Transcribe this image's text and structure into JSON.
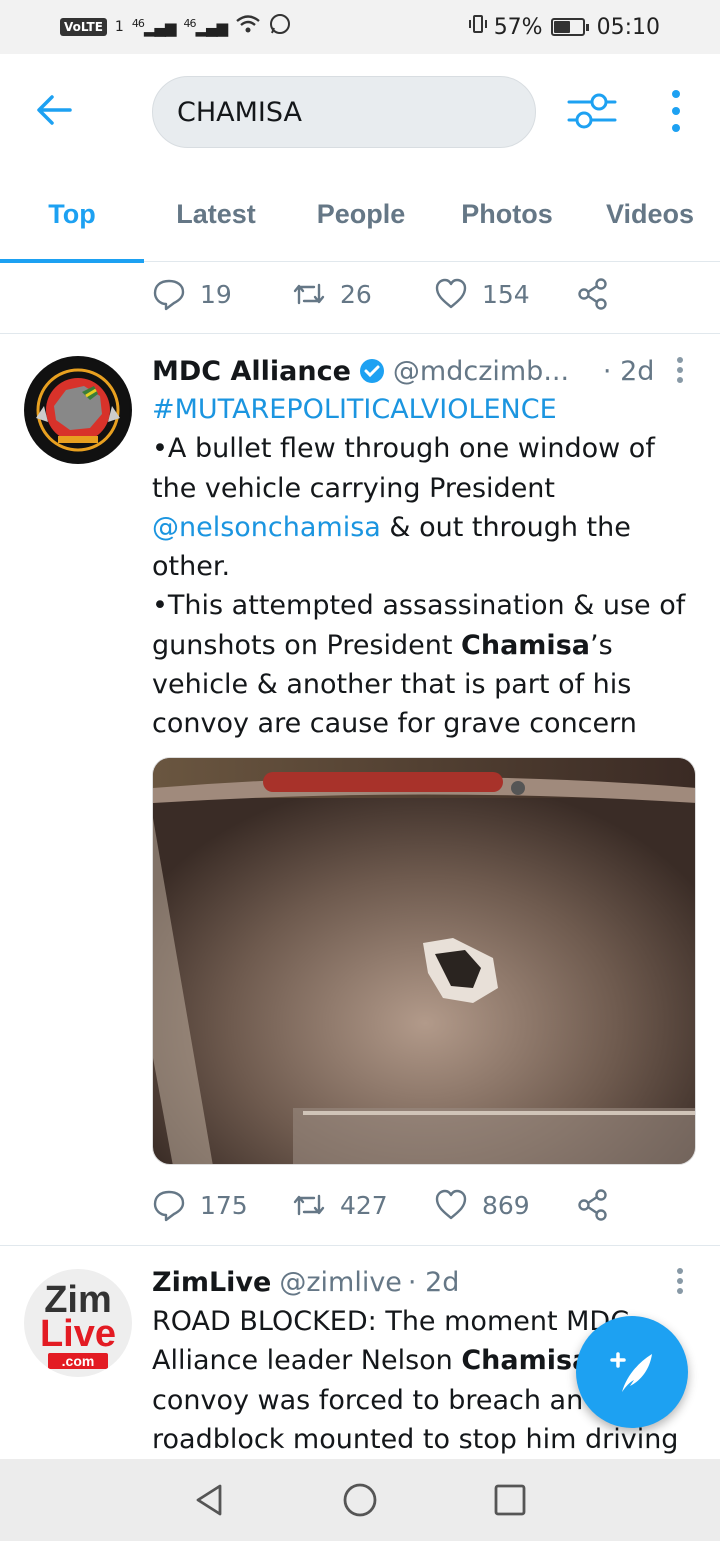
{
  "status_bar": {
    "volte": "VoLTE",
    "sim": "1",
    "net1": "46",
    "net2": "46",
    "battery_percent": "57%",
    "battery_level": 0.57,
    "time": "05:10"
  },
  "search": {
    "query": "CHAMISA"
  },
  "tabs": [
    {
      "label": "Top",
      "active": true
    },
    {
      "label": "Latest",
      "active": false
    },
    {
      "label": "People",
      "active": false
    },
    {
      "label": "Photos",
      "active": false
    },
    {
      "label": "Videos",
      "active": false
    }
  ],
  "prev_tweet_actions": {
    "replies": "19",
    "retweets": "26",
    "likes": "154"
  },
  "tweet1": {
    "name": "MDC Alliance",
    "handle": "@mdczimb...",
    "time": "· 2d",
    "hashtag": "#MUTAREPOLITICALVIOLENCE",
    "line1": "•A bullet flew through one window of",
    "line2": "the vehicle carrying President",
    "mention": "@nelsonchamisa",
    "line3_rest": " & out through the",
    "line4": "other.",
    "line5": "•This attempted assassination & use of",
    "line6_pre": "gunshots on President ",
    "line6_bold": "Chamisa",
    "line6_post": "’s",
    "line7": "vehicle & another that is part of his",
    "line8": "convoy are cause for grave concern",
    "replies": "175",
    "retweets": "427",
    "likes": "869"
  },
  "tweet2": {
    "avatar_text_top": "Zim",
    "avatar_text_mid": "Live",
    "avatar_text_bottom": ".com",
    "name": "ZimLive",
    "handle": "@zimlive",
    "time": "· 2d",
    "line1": "ROAD BLOCKED: The moment MDC",
    "line2_pre": "Alliance leader Nelson ",
    "line2_bold": "Chamisa",
    "line2_post": "'s",
    "line3": "convoy was forced to breach an",
    "line4": "roadblock mounted to stop him driving"
  },
  "colors": {
    "accent": "#1da1f2",
    "muted": "#657786"
  }
}
